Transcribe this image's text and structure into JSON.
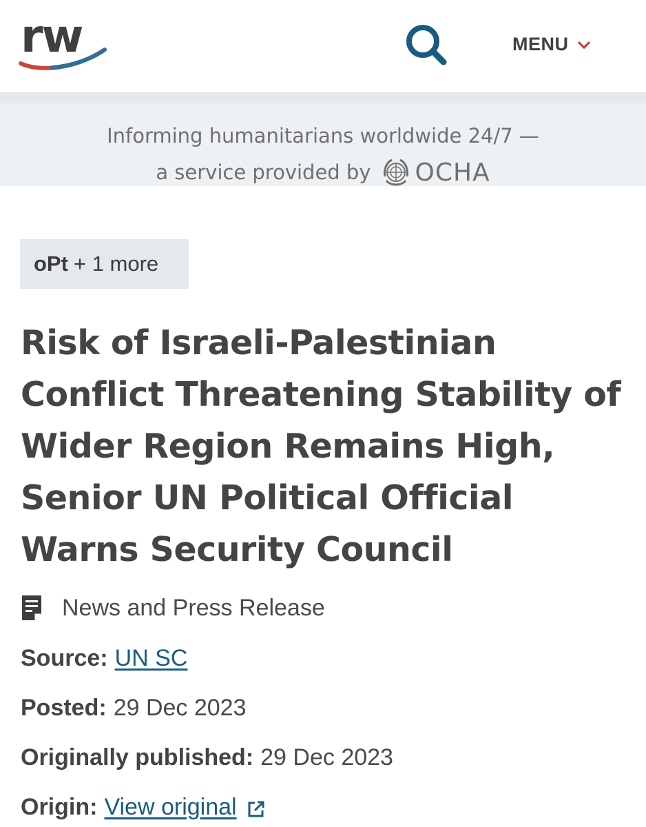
{
  "header": {
    "logo_text": "rw",
    "search_icon": "search-icon",
    "menu_label": "MENU",
    "menu_icon": "chevron-down-icon",
    "accent_color": "#c0392b",
    "link_color": "#1a5b82"
  },
  "banner": {
    "line1": "Informing humanitarians worldwide 24/7 —",
    "line2_prefix": "a service provided by",
    "provider": "OCHA",
    "provider_icon": "un-emblem-icon"
  },
  "tags": {
    "country": "oPt",
    "more": "+ 1 more"
  },
  "article": {
    "title": "Risk of Israeli-Palestinian Conflict Threatening Stability of Wider Region Remains High, Senior UN Political Official Warns Security Council",
    "type_icon": "document-icon",
    "type": "News and Press Release",
    "source_label": "Source:",
    "source_value": "UN SC",
    "posted_label": "Posted:",
    "posted_value": "29 Dec 2023",
    "published_label": "Originally published:",
    "published_value": "29 Dec 2023",
    "origin_label": "Origin:",
    "origin_value": "View original",
    "origin_icon": "external-link-icon"
  }
}
